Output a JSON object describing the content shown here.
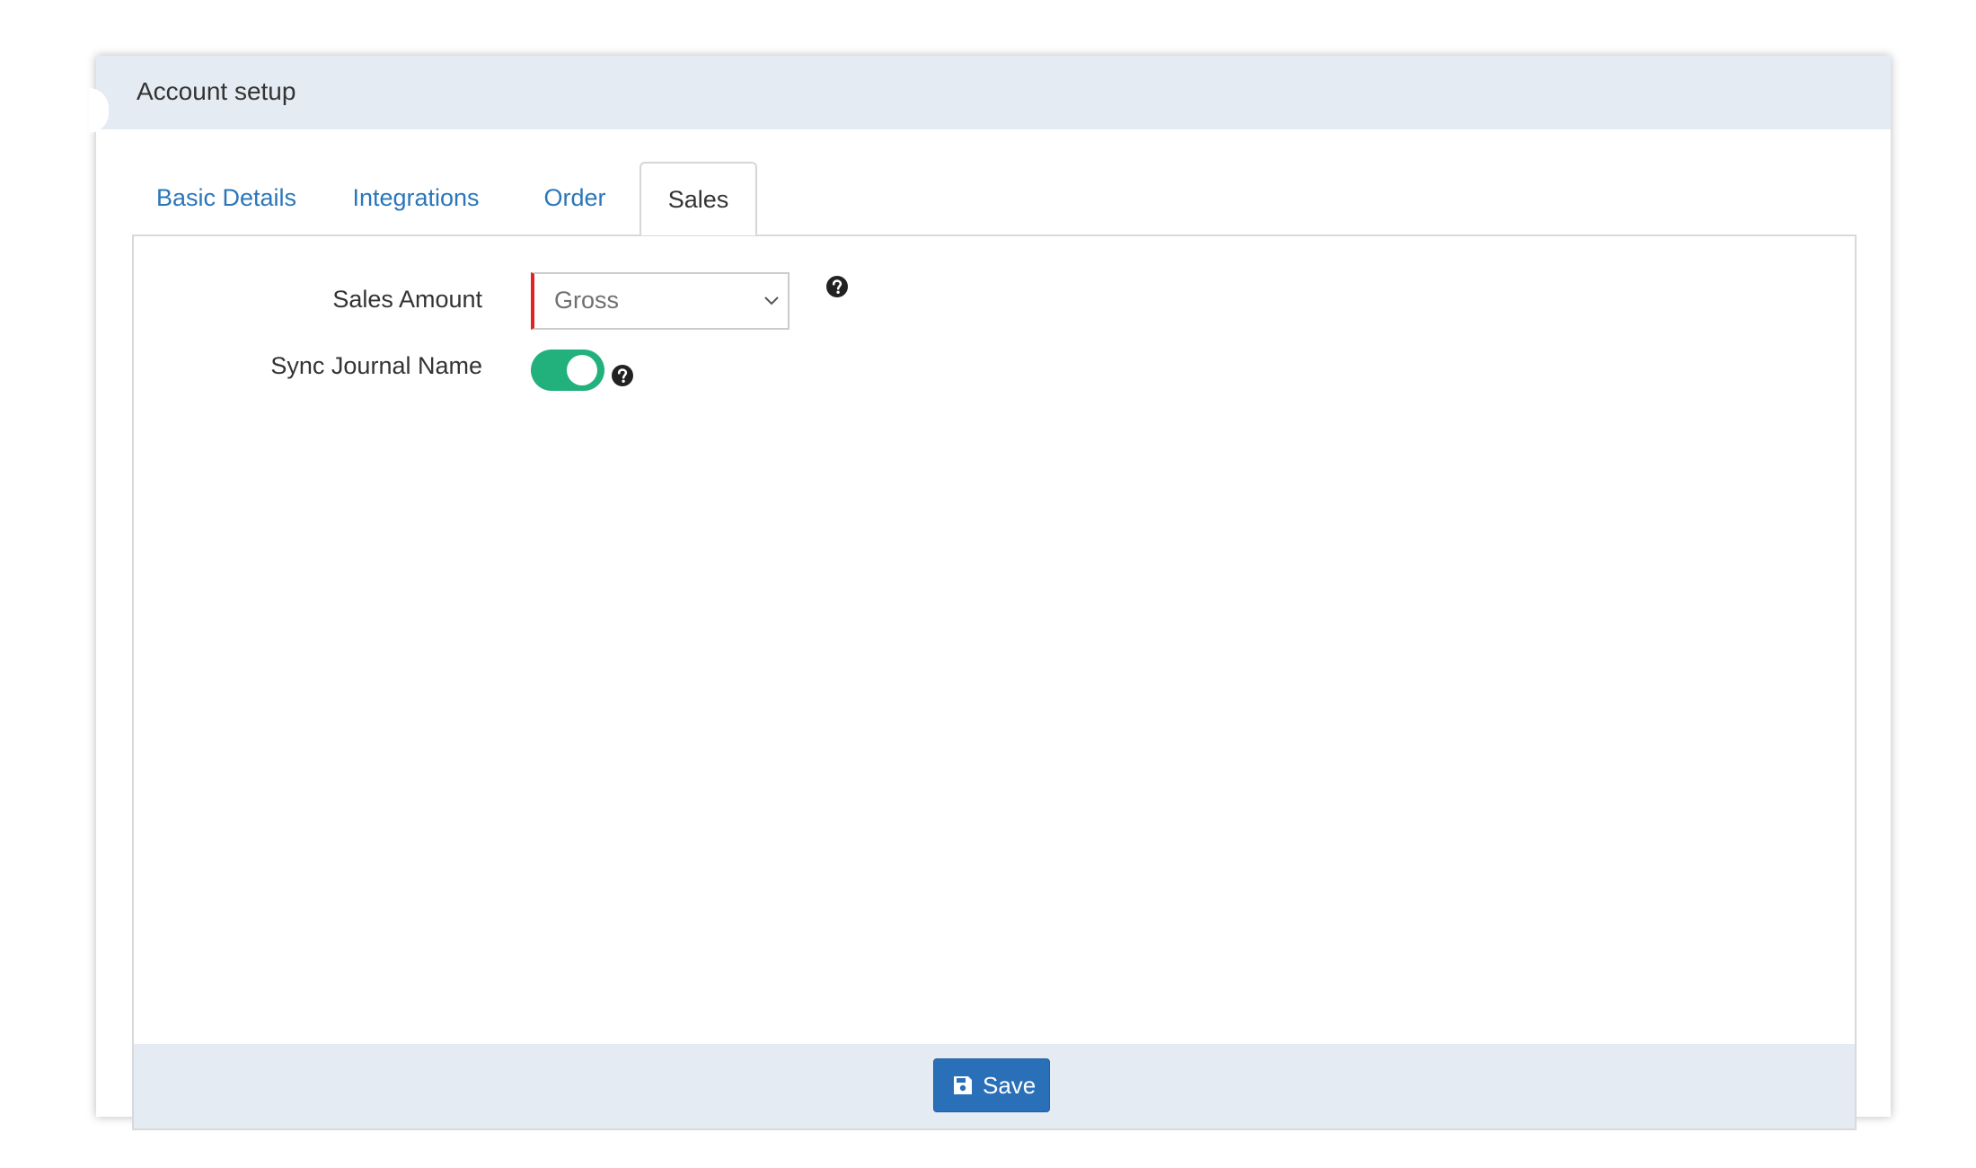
{
  "card": {
    "title": "Account setup"
  },
  "tabs": [
    {
      "label": "Basic Details",
      "active": false
    },
    {
      "label": "Integrations",
      "active": false
    },
    {
      "label": "Order",
      "active": false
    },
    {
      "label": "Sales",
      "active": true
    }
  ],
  "form": {
    "sales_amount": {
      "label": "Sales Amount",
      "value": "Gross",
      "help_icon": "question-circle-icon"
    },
    "sync_journal_name": {
      "label": "Sync Journal Name",
      "enabled": true,
      "help_icon": "question-circle-icon"
    }
  },
  "footer": {
    "save_label": "Save",
    "save_icon": "floppy-disk-icon"
  },
  "colors": {
    "header_bg": "#e4ebf3",
    "link_blue": "#2b76ba",
    "toggle_on": "#22b07d",
    "required_marker": "#e02424",
    "primary_button": "#2a70b8"
  }
}
